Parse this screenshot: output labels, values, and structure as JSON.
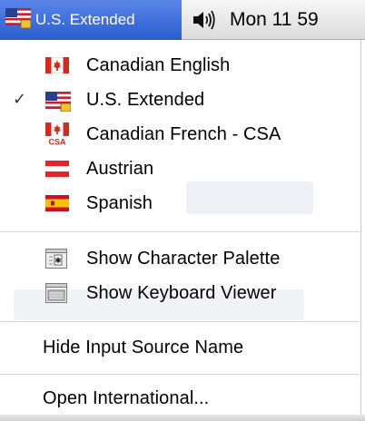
{
  "menubar": {
    "input_source_label": "U.S. Extended",
    "input_source_icon": "us-flag-icon",
    "volume_icon": "speaker-volume-icon",
    "clock": "Mon 11 59"
  },
  "menu": {
    "sources": [
      {
        "label": "Canadian English",
        "icon": "canada-flag-icon",
        "checked": false
      },
      {
        "label": "U.S. Extended",
        "icon": "us-flag-icon",
        "checked": true
      },
      {
        "label": "Canadian French - CSA",
        "icon": "canada-csa-flag-icon",
        "checked": false
      },
      {
        "label": "Austrian",
        "icon": "austria-flag-icon",
        "checked": false
      },
      {
        "label": "Spanish",
        "icon": "spain-flag-icon",
        "checked": false
      }
    ],
    "check_mark": "✓",
    "csa_badge": "CSA",
    "tools": [
      {
        "label": "Show Character Palette",
        "icon": "character-palette-icon"
      },
      {
        "label": "Show Keyboard Viewer",
        "icon": "keyboard-viewer-icon"
      }
    ],
    "hide_name": "Hide Input Source Name",
    "open_intl": "Open International..."
  }
}
